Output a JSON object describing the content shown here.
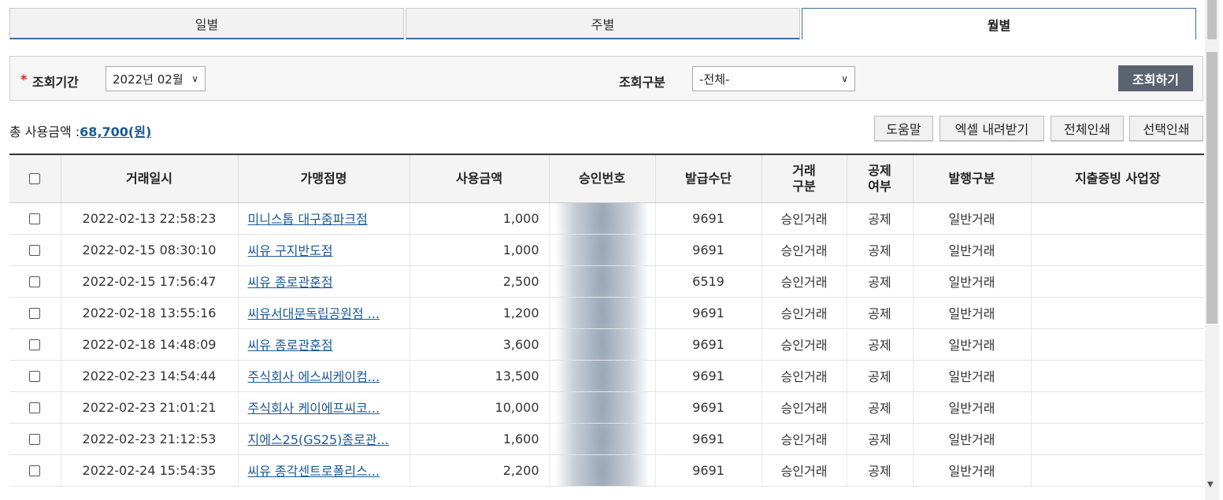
{
  "tabs": [
    {
      "label": "일별",
      "active": false
    },
    {
      "label": "주별",
      "active": false
    },
    {
      "label": "월별",
      "active": true
    }
  ],
  "filter": {
    "required_mark": "*",
    "period_label": "조회기간",
    "period_value": "2022년 02월",
    "type_label": "조회구분",
    "type_value": "-전체-",
    "search_button": "조회하기"
  },
  "summary": {
    "total_label": "총 사용금액 :",
    "total_amount": "68,700(원)"
  },
  "actions": {
    "help": "도움말",
    "excel": "엑셀 내려받기",
    "print_all": "전체인쇄",
    "print_selected": "선택인쇄"
  },
  "table": {
    "headers": {
      "date": "거래일시",
      "merchant": "가맹점명",
      "amount": "사용금액",
      "approval": "승인번호",
      "issue": "발급수단",
      "trade_type_1": "거래",
      "trade_type_2": "구분",
      "deduct_1": "공제",
      "deduct_2": "여부",
      "issue_type": "발행구분",
      "business": "지출증빙 사업장"
    },
    "rows": [
      {
        "date": "2022-02-13 22:58:23",
        "merchant": "미니스톱 대구줌파크점",
        "amount": "1,000",
        "approval": "",
        "issue": "9691",
        "trade": "승인거래",
        "deduct": "공제",
        "issue_type": "일반거래",
        "business": ""
      },
      {
        "date": "2022-02-15 08:30:10",
        "merchant": "씨유 구지반도점",
        "amount": "1,000",
        "approval": "",
        "issue": "9691",
        "trade": "승인거래",
        "deduct": "공제",
        "issue_type": "일반거래",
        "business": ""
      },
      {
        "date": "2022-02-15 17:56:47",
        "merchant": "씨유 종로관훈점",
        "amount": "2,500",
        "approval": "",
        "issue": "6519",
        "trade": "승인거래",
        "deduct": "공제",
        "issue_type": "일반거래",
        "business": ""
      },
      {
        "date": "2022-02-18 13:55:16",
        "merchant": "씨유서대문독립공원점 ...",
        "amount": "1,200",
        "approval": "",
        "issue": "9691",
        "trade": "승인거래",
        "deduct": "공제",
        "issue_type": "일반거래",
        "business": ""
      },
      {
        "date": "2022-02-18 14:48:09",
        "merchant": "씨유 종로관훈점",
        "amount": "3,600",
        "approval": "",
        "issue": "9691",
        "trade": "승인거래",
        "deduct": "공제",
        "issue_type": "일반거래",
        "business": ""
      },
      {
        "date": "2022-02-23 14:54:44",
        "merchant": "주식회사 에스씨케이컴...",
        "amount": "13,500",
        "approval": "",
        "issue": "9691",
        "trade": "승인거래",
        "deduct": "공제",
        "issue_type": "일반거래",
        "business": ""
      },
      {
        "date": "2022-02-23 21:01:21",
        "merchant": "주식회사 케이에프씨코...",
        "amount": "10,000",
        "approval": "",
        "issue": "9691",
        "trade": "승인거래",
        "deduct": "공제",
        "issue_type": "일반거래",
        "business": ""
      },
      {
        "date": "2022-02-23 21:12:53",
        "merchant": "지에스25(GS25)종로관...",
        "amount": "1,600",
        "approval": "",
        "issue": "9691",
        "trade": "승인거래",
        "deduct": "공제",
        "issue_type": "일반거래",
        "business": ""
      },
      {
        "date": "2022-02-24 15:54:35",
        "merchant": "씨유 종각센트로폴리스...",
        "amount": "2,200",
        "approval": "",
        "issue": "9691",
        "trade": "승인거래",
        "deduct": "공제",
        "issue_type": "일반거래",
        "business": ""
      }
    ]
  },
  "colors": {
    "accent_blue": "#3d6c9e",
    "link": "#1b5a96",
    "required": "#e31d1d",
    "search_button_bg": "#5b6270"
  }
}
